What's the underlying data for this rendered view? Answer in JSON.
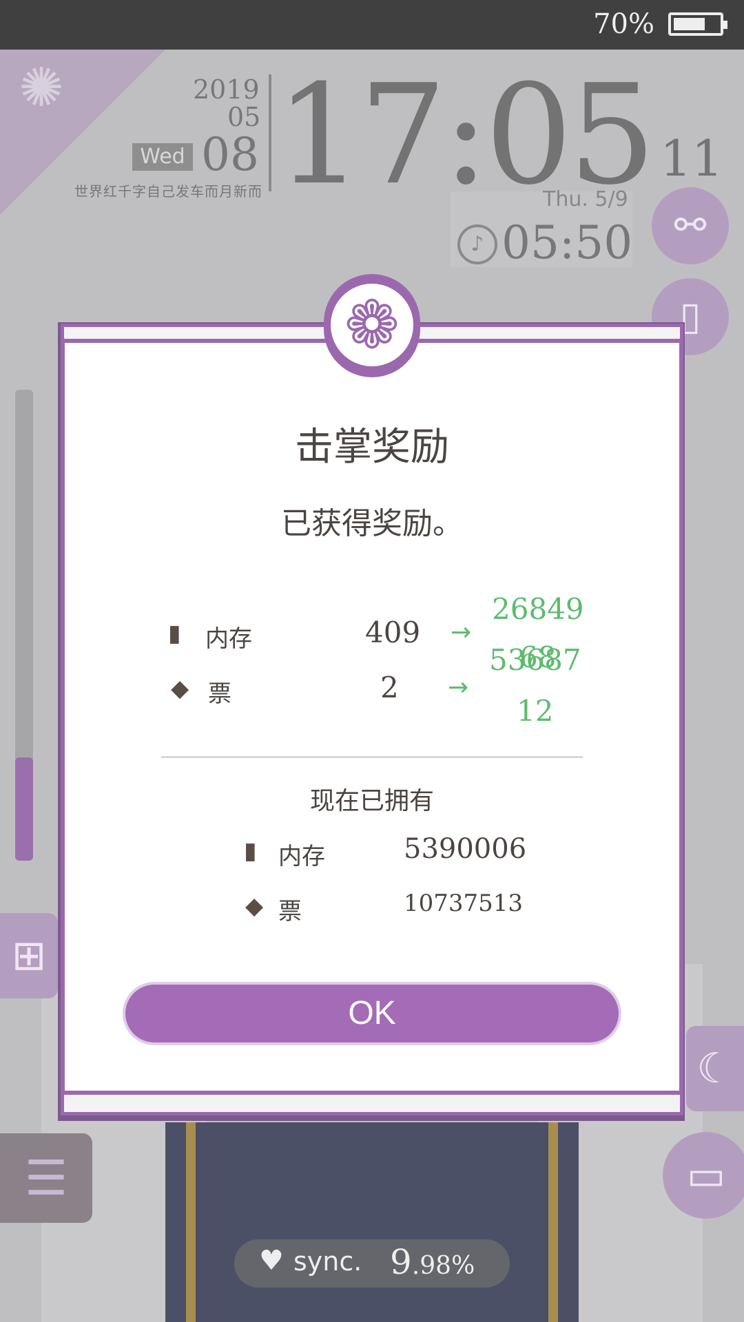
{
  "status_bar": {
    "battery_text": "70%",
    "battery_level": 0.7
  },
  "clock": {
    "year": "2019",
    "month": "05",
    "weekday": "Wed",
    "day": "08",
    "subtitle": "世界红千字自己发车而月新而",
    "time": "17:05",
    "seconds": "11",
    "next_alarm_date": "Thu.  5/9",
    "alarm_time": "05:50"
  },
  "side_icons": {
    "share": "share-icon",
    "book_top": "book-icon",
    "gift": "gift-icon",
    "moon": "moon-icon",
    "menu": "menu-icon",
    "book_bottom": "book-open-icon"
  },
  "sync": {
    "label": "sync.",
    "value_int": "9",
    "value_dec": ".98%"
  },
  "dialog": {
    "title": "击掌奖励",
    "subtitle": "已获得奖励。",
    "rewards": [
      {
        "icon": "memory-icon",
        "label": "内存",
        "from": "409",
        "arrow": "→",
        "to": "26849",
        "to_alt": "53687",
        "to_alt2": "68"
      },
      {
        "icon": "ticket-icon",
        "label": "票",
        "from": "2",
        "arrow": "→",
        "to": "12"
      }
    ],
    "owned_title": "现在已拥有",
    "owned": [
      {
        "icon": "memory-icon",
        "label": "内存",
        "value": "5390006"
      },
      {
        "icon": "ticket-icon",
        "label": "票",
        "value": "10737513"
      }
    ],
    "ok_label": "OK"
  },
  "colors": {
    "accent": "#9b68ae",
    "ok_button": "#a46cb7",
    "gain_green": "#5dbb6e",
    "text_dark": "#4b4542"
  }
}
